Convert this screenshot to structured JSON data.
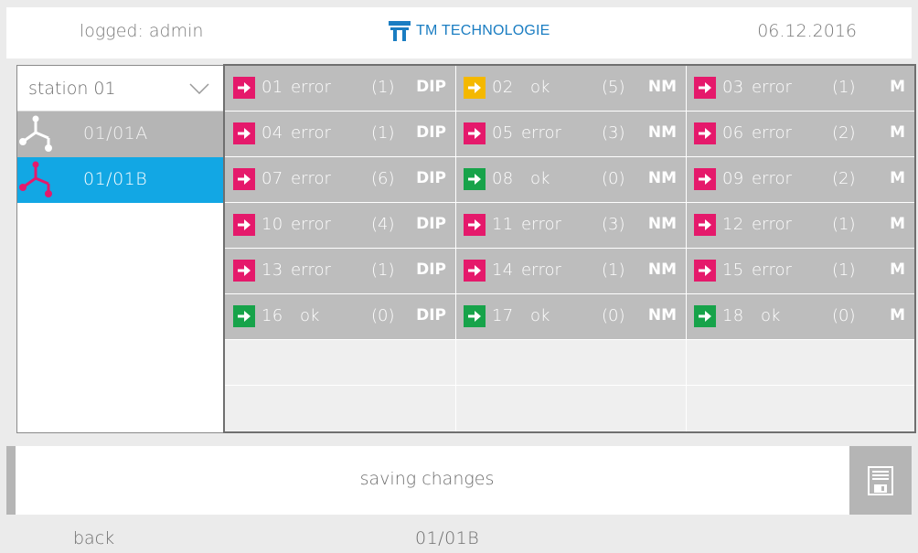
{
  "header": {
    "user": "logged: admin",
    "brand": "TM TECHNOLOGIE",
    "date": "06.12.2016"
  },
  "sidebar": {
    "station_select": "station 01",
    "items": [
      {
        "label": "01/01A",
        "state": "grey",
        "icon": "branch-node-icon"
      },
      {
        "label": "01/01B",
        "state": "selected",
        "icon": "branch-node-icon"
      }
    ]
  },
  "grid": {
    "rows": [
      [
        {
          "num": "01",
          "status": "error",
          "count": "(1)",
          "type": "DIP",
          "color": "#e5196b"
        },
        {
          "num": "02",
          "status": "ok",
          "count": "(5)",
          "type": "NM",
          "color": "#f4b800"
        },
        {
          "num": "03",
          "status": "error",
          "count": "(1)",
          "type": "M",
          "color": "#e5196b"
        }
      ],
      [
        {
          "num": "04",
          "status": "error",
          "count": "(1)",
          "type": "DIP",
          "color": "#e5196b"
        },
        {
          "num": "05",
          "status": "error",
          "count": "(3)",
          "type": "NM",
          "color": "#e5196b"
        },
        {
          "num": "06",
          "status": "error",
          "count": "(2)",
          "type": "M",
          "color": "#e5196b"
        }
      ],
      [
        {
          "num": "07",
          "status": "error",
          "count": "(6)",
          "type": "DIP",
          "color": "#e5196b"
        },
        {
          "num": "08",
          "status": "ok",
          "count": "(0)",
          "type": "NM",
          "color": "#17a34a"
        },
        {
          "num": "09",
          "status": "error",
          "count": "(2)",
          "type": "M",
          "color": "#e5196b"
        }
      ],
      [
        {
          "num": "10",
          "status": "error",
          "count": "(4)",
          "type": "DIP",
          "color": "#e5196b"
        },
        {
          "num": "11",
          "status": "error",
          "count": "(3)",
          "type": "NM",
          "color": "#e5196b"
        },
        {
          "num": "12",
          "status": "error",
          "count": "(1)",
          "type": "M",
          "color": "#e5196b"
        }
      ],
      [
        {
          "num": "13",
          "status": "error",
          "count": "(1)",
          "type": "DIP",
          "color": "#e5196b"
        },
        {
          "num": "14",
          "status": "error",
          "count": "(1)",
          "type": "NM",
          "color": "#e5196b"
        },
        {
          "num": "15",
          "status": "error",
          "count": "(1)",
          "type": "M",
          "color": "#e5196b"
        }
      ],
      [
        {
          "num": "16",
          "status": "ok",
          "count": "(0)",
          "type": "DIP",
          "color": "#17a34a"
        },
        {
          "num": "17",
          "status": "ok",
          "count": "(0)",
          "type": "NM",
          "color": "#17a34a"
        },
        {
          "num": "18",
          "status": "ok",
          "count": "(0)",
          "type": "M",
          "color": "#17a34a"
        }
      ]
    ],
    "empty_rows": 2
  },
  "savebar": {
    "text": "saving changes",
    "save_icon": "floppy-disk-icon"
  },
  "footer": {
    "back": "back",
    "selected": "01/01B"
  },
  "colors": {
    "error": "#e5196b",
    "ok": "#17a34a",
    "warning": "#f4b800",
    "selected": "#12a7e4",
    "brand": "#1a7dc2"
  }
}
